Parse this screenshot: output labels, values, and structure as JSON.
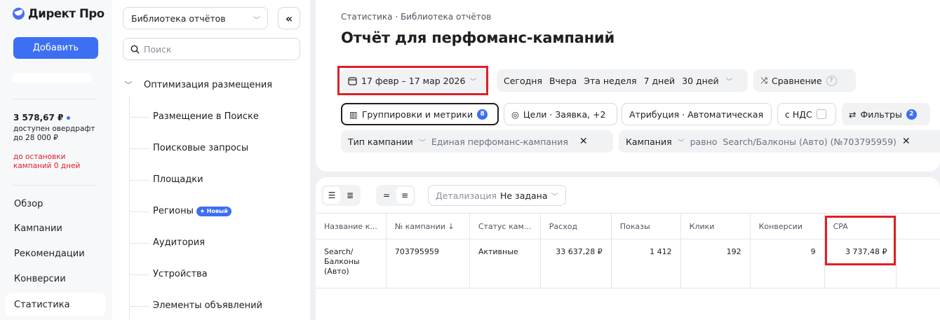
{
  "sidebar": {
    "logo": "Директ Про",
    "add_button": "Добавить",
    "balance": "3 578,67 ₽",
    "overdraft_line1": "доступен овердрафт",
    "overdraft_line2": "до 28 000 ₽",
    "stop_line1": "до остановки",
    "stop_line2": "кампаний 0 дней",
    "nav": [
      "Обзор",
      "Кампании",
      "Рекомендации",
      "Конверсии",
      "Статистика"
    ],
    "active_nav": "Статистика"
  },
  "library": {
    "select_label": "Библиотека отчётов",
    "collapse_icon": "«",
    "search_placeholder": "Поиск",
    "group": "Оптимизация размещения",
    "items": [
      "Размещение в Поиске",
      "Поисковые запросы",
      "Площадки",
      "Регионы",
      "Аудитория",
      "Устройства",
      "Элементы объявлений"
    ],
    "new_badge": "★ Новый"
  },
  "header": {
    "breadcrumb": "Статистика · Библиотека отчётов",
    "title": "Отчёт для перфоманс-кампаний"
  },
  "filters": {
    "date_range": "17 февр – 17 мар 2026",
    "today": "Сегодня",
    "yesterday": "Вчера",
    "this_week": "Эта неделя",
    "days7": "7 дней",
    "days30": "30 дней",
    "compare": "Сравнение",
    "groupings": "Группировки и метрики",
    "groupings_count": "8",
    "goals": "Цели · Заявка, +2",
    "attribution": "Атрибуция · Автоматическая",
    "vat": "с НДС",
    "filters_label": "Фильтры",
    "filters_count": "2",
    "type_label": "Тип кампании",
    "type_value": "Единая перфоманс-кампания",
    "campaign_label": "Кампания",
    "campaign_op": "равно",
    "campaign_value": "Search/Балконы (Авто) (№703795959)"
  },
  "toolbar": {
    "detail_label": "Детализация",
    "detail_value": "Не задана"
  },
  "table": {
    "columns": [
      "Название к...",
      "№ кампании ↓",
      "Статус кам...",
      "Расход",
      "Показы",
      "Клики",
      "Конверсии",
      "CPA"
    ],
    "rows": [
      {
        "name": "Search/ Балконы (Авто)",
        "id": "703795959",
        "status": "Активные",
        "spend": "33 637,28 ₽",
        "impressions": "1 412",
        "clicks": "192",
        "conversions": "9",
        "cpa": "3 737,48 ₽"
      }
    ]
  },
  "colors": {
    "accent": "#3d6ff2",
    "highlight": "#e01f26"
  }
}
